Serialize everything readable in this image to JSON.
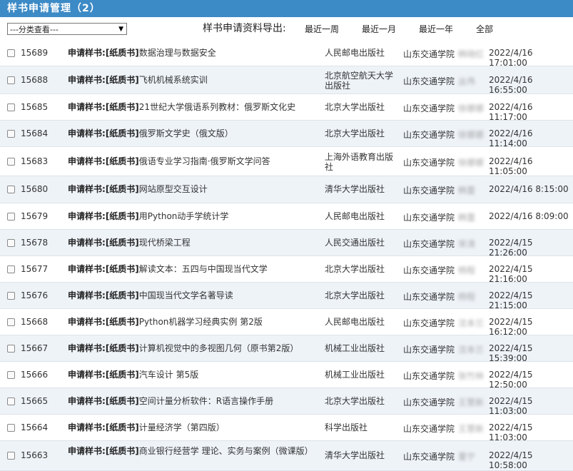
{
  "header": {
    "title": "样书申请管理（2）"
  },
  "toolbar": {
    "filter_select": "---分类查看---",
    "export_label": "样书申请资料导出:",
    "export_links": [
      "最近一周",
      "最近一月",
      "最近一年",
      "全部"
    ]
  },
  "rows": [
    {
      "id": "15689",
      "lead": "申请样书:",
      "tag": "[纸质书]",
      "book": "数据治理与数据安全",
      "publisher": "人民邮电出版社",
      "school": "山东交通学院",
      "person": "韩晓红",
      "date": "2022/4/16 17:01:00"
    },
    {
      "id": "15688",
      "lead": "申请样书:",
      "tag": "[纸质书]",
      "book": "飞机机械系统实训",
      "publisher": "北京航空航天大学出版社",
      "school": "山东交通学院",
      "person": "丛伟",
      "date": "2022/4/16 16:55:00"
    },
    {
      "id": "15685",
      "lead": "申请样书:",
      "tag": "[纸质书]",
      "book": "21世纪大学俄语系列教材：俄罗斯文化史",
      "publisher": "北京大学出版社",
      "school": "山东交通学院",
      "person": "徐娜娜",
      "date": "2022/4/16 11:17:00"
    },
    {
      "id": "15684",
      "lead": "申请样书:",
      "tag": "[纸质书]",
      "book": "俄罗斯文学史（俄文版）",
      "publisher": "北京大学出版社",
      "school": "山东交通学院",
      "person": "徐娜娜",
      "date": "2022/4/16 11:14:00"
    },
    {
      "id": "15683",
      "lead": "申请样书:",
      "tag": "[纸质书]",
      "book": "俄语专业学习指南·俄罗斯文学问答",
      "publisher": "上海外语教育出版社",
      "school": "山东交通学院",
      "person": "徐娜娜",
      "date": "2022/4/16 11:05:00"
    },
    {
      "id": "15680",
      "lead": "申请样书:",
      "tag": "[纸质书]",
      "book": "网站原型交互设计",
      "publisher": "清华大学出版社",
      "school": "山东交通学院",
      "person": "韩蕾",
      "date": "2022/4/16 8:15:00"
    },
    {
      "id": "15679",
      "lead": "申请样书:",
      "tag": "[纸质书]",
      "book": "用Python动手学统计学",
      "publisher": "人民邮电出版社",
      "school": "山东交通学院",
      "person": "韩蕾",
      "date": "2022/4/16 8:09:00"
    },
    {
      "id": "15678",
      "lead": "申请样书:",
      "tag": "[纸质书]",
      "book": "现代桥梁工程",
      "publisher": "人民交通出版社",
      "school": "山东交通学院",
      "person": "宋涛",
      "date": "2022/4/15 21:26:00"
    },
    {
      "id": "15677",
      "lead": "申请样书:",
      "tag": "[纸质书]",
      "book": "解读文本：五四与中国现当代文学",
      "publisher": "北京大学出版社",
      "school": "山东交通学院",
      "person": "杨程",
      "date": "2022/4/15 21:16:00"
    },
    {
      "id": "15676",
      "lead": "申请样书:",
      "tag": "[纸质书]",
      "book": "中国现当代文学名著导读",
      "publisher": "北京大学出版社",
      "school": "山东交通学院",
      "person": "杨程",
      "date": "2022/4/15 21:15:00"
    },
    {
      "id": "15668",
      "lead": "申请样书:",
      "tag": "[纸质书]",
      "book": "Python机器学习经典实例 第2版",
      "publisher": "人民邮电出版社",
      "school": "山东交通学院",
      "person": "沈本兰",
      "date": "2022/4/15 16:12:00"
    },
    {
      "id": "15667",
      "lead": "申请样书:",
      "tag": "[纸质书]",
      "book": "计算机视觉中的多视图几何（原书第2版）",
      "publisher": "机械工业出版社",
      "school": "山东交通学院",
      "person": "沈本兰",
      "date": "2022/4/15 15:39:00"
    },
    {
      "id": "15666",
      "lead": "申请样书:",
      "tag": "[纸质书]",
      "book": "汽车设计 第5版",
      "publisher": "机械工业出版社",
      "school": "山东交通学院",
      "person": "张竹林",
      "date": "2022/4/15 12:50:00"
    },
    {
      "id": "15665",
      "lead": "申请样书:",
      "tag": "[纸质书]",
      "book": "空间计量分析软件：R语言操作手册",
      "publisher": "北京大学出版社",
      "school": "山东交通学院",
      "person": "王慧新",
      "date": "2022/4/15 11:03:00"
    },
    {
      "id": "15664",
      "lead": "申请样书:",
      "tag": "[纸质书]",
      "book": "计量经济学（第四版）",
      "publisher": "科学出版社",
      "school": "山东交通学院",
      "person": "王慧新",
      "date": "2022/4/15 11:03:00"
    },
    {
      "id": "15663",
      "lead": "申请样书:",
      "tag": "[纸质书]",
      "book": "商业银行经营学 理论、实务与案例（微课版）",
      "publisher": "清华大学出版社",
      "school": "山东交通学院",
      "person": "董宁",
      "date": "2022/4/15 10:58:00"
    }
  ]
}
